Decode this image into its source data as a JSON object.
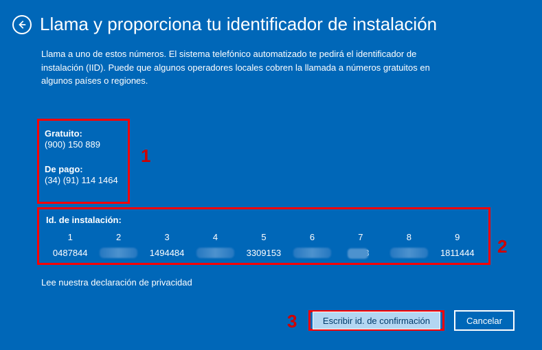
{
  "header": {
    "title": "Llama y proporciona tu identificador de instalación"
  },
  "description": "Llama a uno de estos números. El sistema telefónico automatizado te pedirá el identificador de instalación (IID). Puede que algunos operadores locales cobren la llamada a números gratuitos en algunos países o regiones.",
  "phones": {
    "free_label": "Gratuito:",
    "free_number": "(900) 150 889",
    "paid_label": "De pago:",
    "paid_number": "(34) (91) 114 1464"
  },
  "annotations": {
    "a1": "1",
    "a2": "2",
    "a3": "3"
  },
  "iid": {
    "title": "Id. de instalación:",
    "headers": [
      "1",
      "2",
      "3",
      "4",
      "5",
      "6",
      "7",
      "8",
      "9"
    ],
    "values": [
      "0487844",
      "",
      "1494484",
      "",
      "3309153",
      "",
      "1       33",
      "",
      "1811444"
    ]
  },
  "privacy_link": "Lee nuestra declaración de privacidad",
  "buttons": {
    "confirm": "Escribir id. de confirmación",
    "cancel": "Cancelar"
  }
}
